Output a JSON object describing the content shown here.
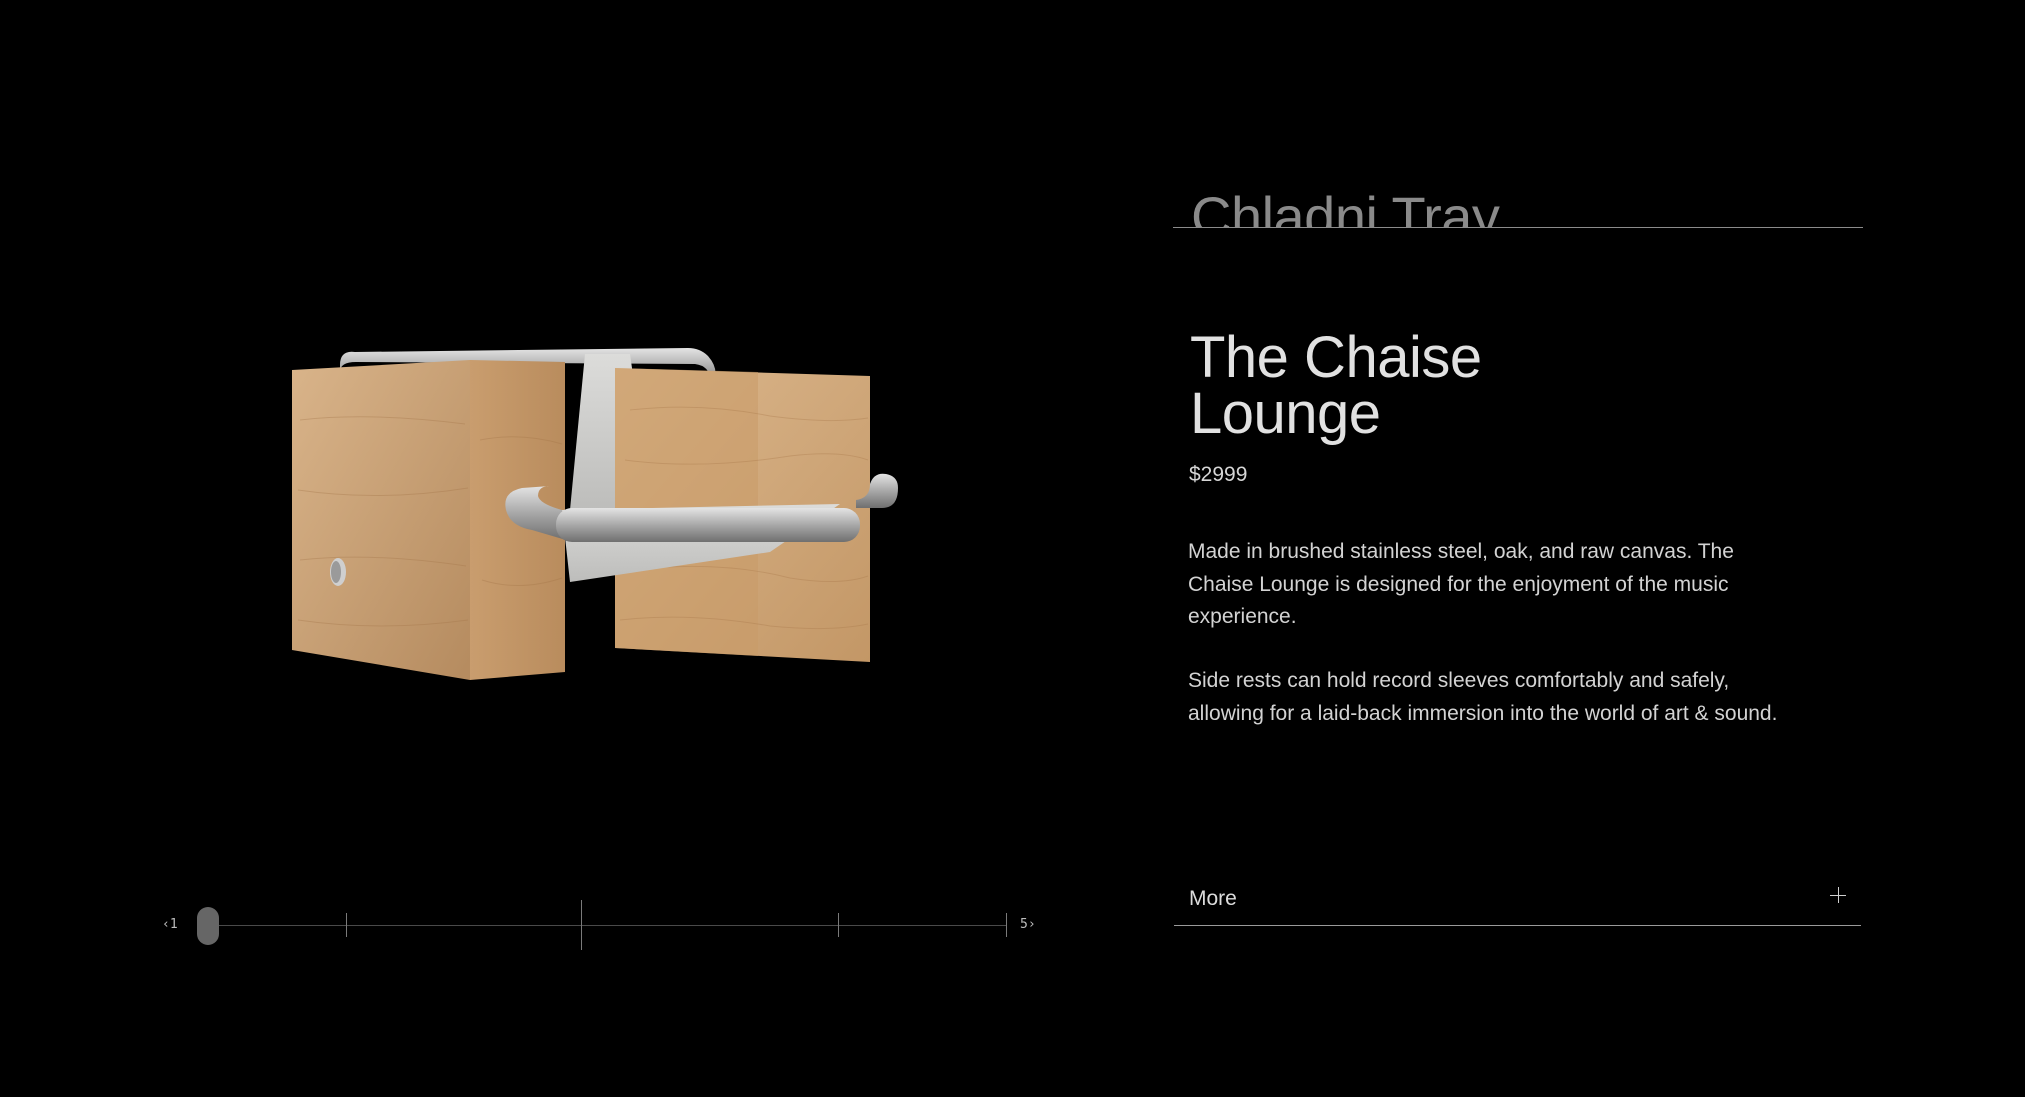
{
  "upcoming_product": {
    "title": "Chladni Tray"
  },
  "product": {
    "title_line_1": "The Chaise",
    "title_line_2": "Lounge",
    "price": "$2999",
    "description_paragraph_1": "Made in brushed stainless steel, oak, and raw canvas. The Chaise Lounge is designed for the enjoyment of the music experience.",
    "description_paragraph_2": "Side rests can hold record sleeves comfortably and safely, allowing for a laid-back immersion into the world of art & sound."
  },
  "slider": {
    "prev_label": "‹1",
    "next_label": "5›",
    "current_index": 1,
    "total": 5
  },
  "more": {
    "label": "More",
    "icon": "plus-icon"
  },
  "colors": {
    "background": "#000000",
    "wood": "#c89c6c",
    "steel": "#b9b9b9",
    "canvas": "#d4d4d2"
  }
}
